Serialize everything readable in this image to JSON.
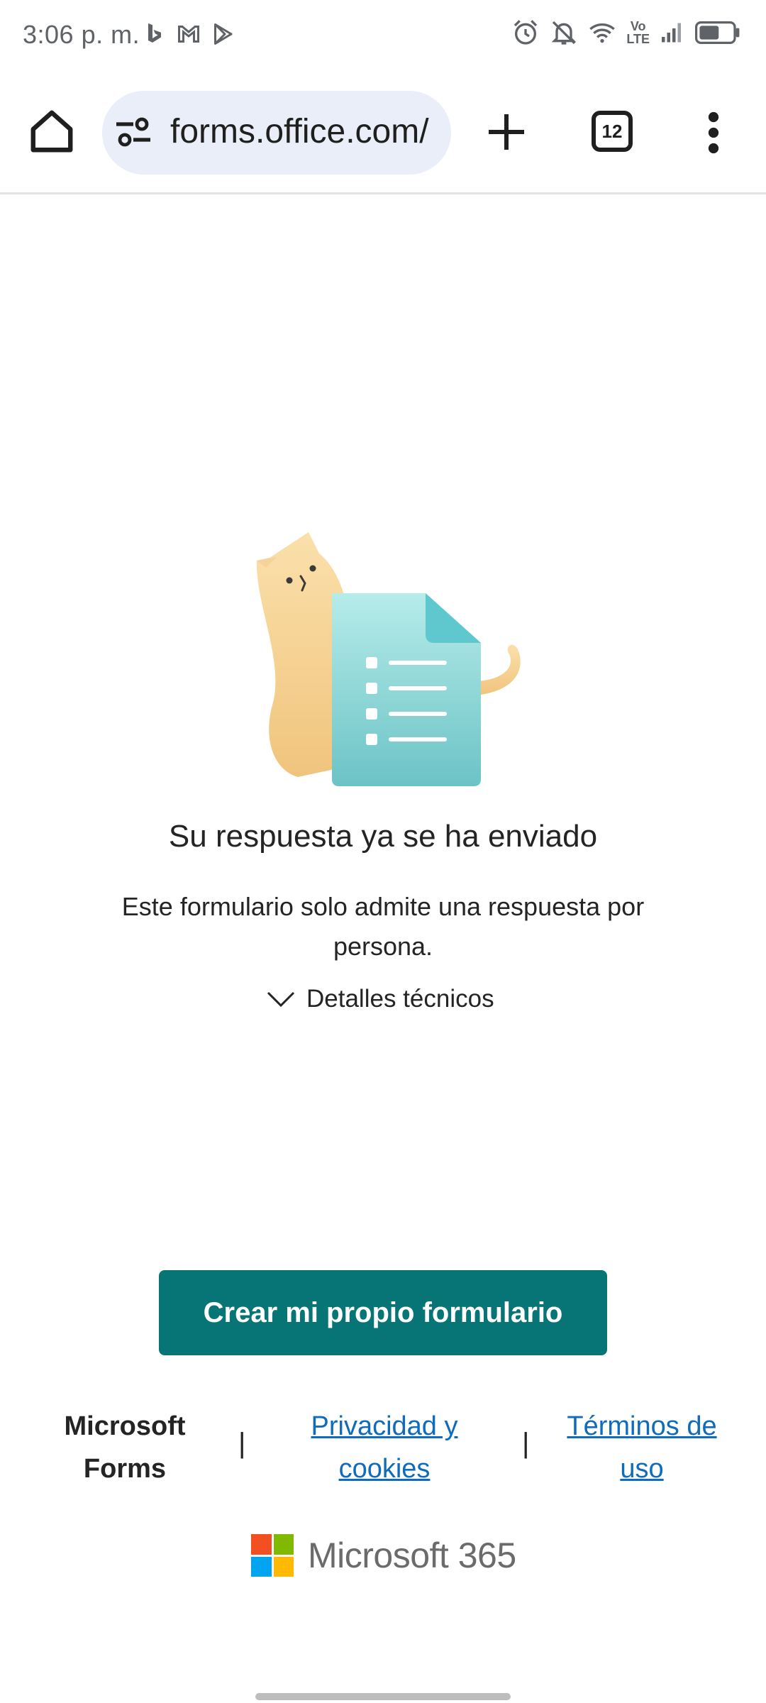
{
  "status_bar": {
    "time": "3:06 p. m.",
    "app_icons": [
      "bing-icon",
      "gmail-icon",
      "play-store-icon"
    ],
    "right_icons": [
      "alarm-icon",
      "mute-icon",
      "wifi-icon",
      "volte-icon",
      "signal-icon",
      "battery-icon"
    ],
    "volte_label_top": "Vo",
    "volte_label_bottom": "LTE",
    "battery_level": 0.6
  },
  "browser": {
    "url": "forms.office.com/",
    "tab_count": "12"
  },
  "main": {
    "heading": "Su respuesta ya se ha enviado",
    "description": "Este formulario solo admite una respuesta por persona.",
    "details_label": "Detalles técnicos",
    "create_button_label": "Crear mi propio formulario"
  },
  "footer": {
    "brand": "Microsoft Forms",
    "separator": "|",
    "privacy_link": "Privacidad y cookies",
    "terms_link": "Términos de uso",
    "product_name": "Microsoft 365"
  },
  "colors": {
    "primary_button": "#077575",
    "link": "#0f6cbd",
    "url_bar_bg": "#e9eef8",
    "ms_red": "#f25022",
    "ms_green": "#7fba00",
    "ms_blue": "#00a4ef",
    "ms_yellow": "#ffb900"
  }
}
